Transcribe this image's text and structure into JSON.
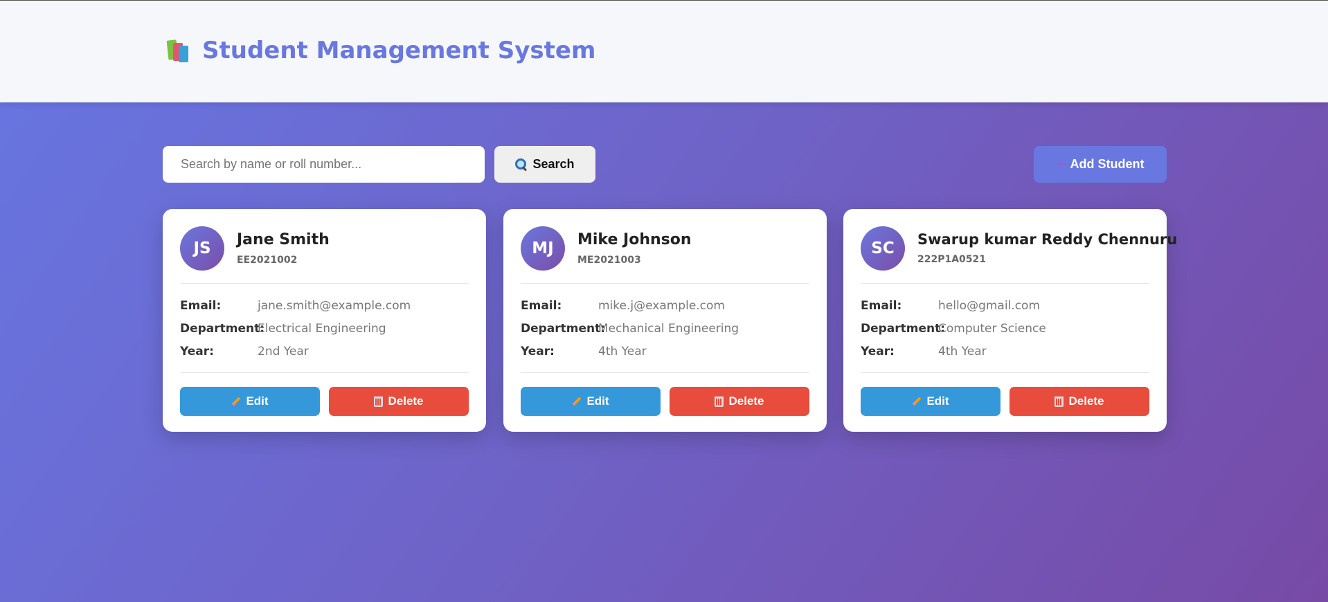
{
  "header": {
    "title": "Student Management System",
    "icon": "books-icon"
  },
  "toolbar": {
    "search_placeholder": "Search by name or roll number...",
    "search_value": "",
    "search_label": "Search",
    "add_label": "Add Student"
  },
  "labels": {
    "email": "Email:",
    "department": "Department:",
    "year": "Year:",
    "edit": "Edit",
    "delete": "Delete"
  },
  "students": [
    {
      "initials": "JS",
      "name": "Jane Smith",
      "roll": "EE2021002",
      "email": "jane.smith@example.com",
      "department": "Electrical Engineering",
      "year": "2nd Year"
    },
    {
      "initials": "MJ",
      "name": "Mike Johnson",
      "roll": "ME2021003",
      "email": "mike.j@example.com",
      "department": "Mechanical Engineering",
      "year": "4th Year"
    },
    {
      "initials": "SC",
      "name": "Swarup kumar Reddy Chennuru",
      "roll": "222P1A0521",
      "email": "hello@gmail.com",
      "department": "Computer Science",
      "year": "4th Year"
    }
  ],
  "colors": {
    "accent": "#6878e0",
    "edit": "#3498db",
    "delete": "#e74c3c"
  }
}
